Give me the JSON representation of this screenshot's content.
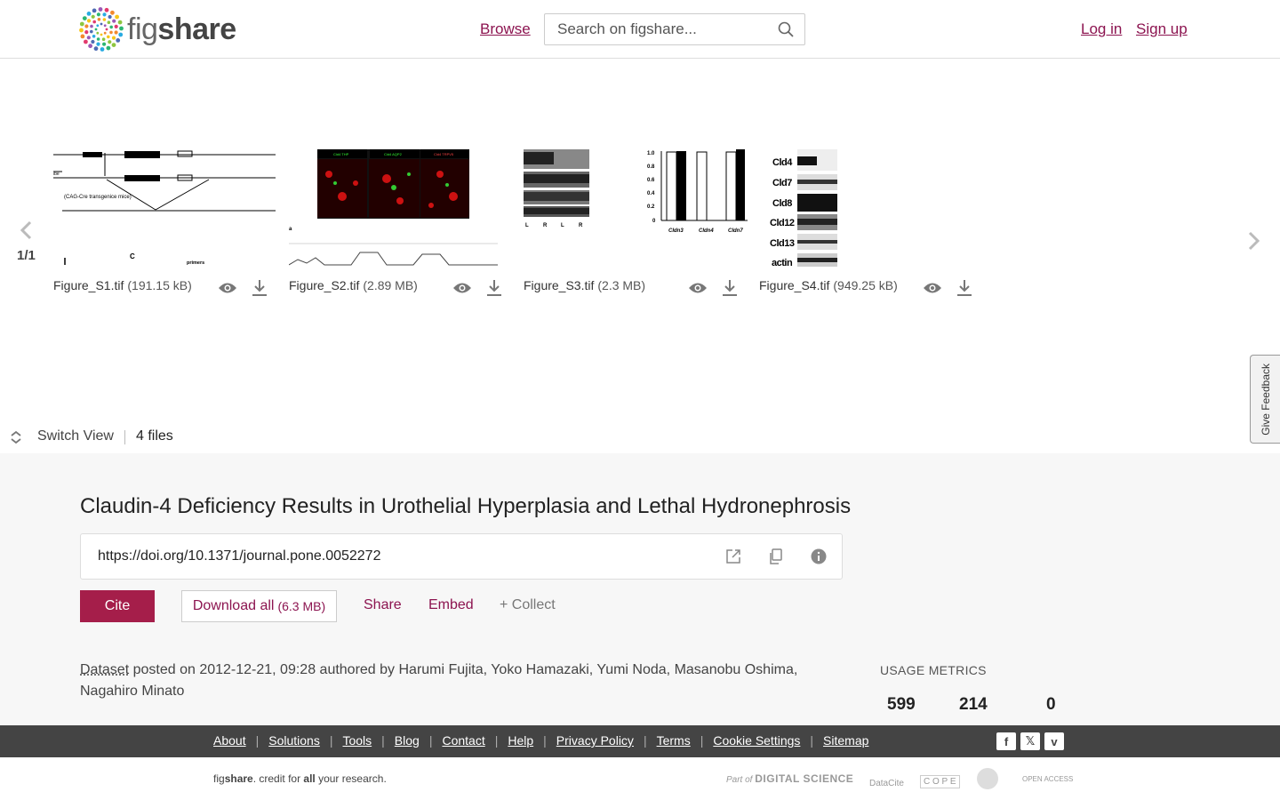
{
  "header": {
    "logo_fig": "fig",
    "logo_share": "share",
    "browse": "Browse",
    "search_placeholder": "Search on figshare...",
    "login": "Log in",
    "signup": "Sign up"
  },
  "carousel": {
    "pager": "1/1",
    "files": [
      {
        "name": "Figure_S1.tif",
        "size": "(191.15 kB)"
      },
      {
        "name": "Figure_S2.tif",
        "size": "(2.89 MB)"
      },
      {
        "name": "Figure_S3.tif",
        "size": "(2.3 MB)"
      },
      {
        "name": "Figure_S4.tif",
        "size": "(949.25 kB)"
      }
    ],
    "s1_labels": {
      "label_a": "(CAG-Cre transgenice mice)",
      "label_b": "C",
      "label_c": "primers",
      "label_d": "ibe"
    },
    "s2_labels": {
      "a": "Cld4 THP",
      "b": "Cld4 AQP2",
      "c": "Cld4 TRPV5"
    },
    "s3_labels": [
      "L",
      "R",
      "L",
      "R"
    ],
    "s3_chart_ticks": [
      "1.0",
      "0.8",
      "0.6",
      "0.4",
      "0.2",
      "0"
    ],
    "s3_chart_cats": [
      "Cldn3",
      "Cldn4",
      "Cldn7"
    ],
    "s4_labels": [
      "Cld4",
      "Cld7",
      "Cld8",
      "Cld12",
      "Cld13",
      "actin"
    ]
  },
  "feedback": "Give Feedback",
  "switch_view": "Switch View",
  "files_count": "4 files",
  "article": {
    "title": "Claudin-4 Deficiency Results in Urothelial Hyperplasia and Lethal Hydronephrosis",
    "doi": "https://doi.org/10.1371/journal.pone.0052272",
    "cite": "Cite",
    "download_all": "Download all",
    "download_size": "(6.3 MB)",
    "share": "Share",
    "embed": "Embed",
    "collect": "+ Collect",
    "type": "Dataset",
    "posted": "posted on 2012-12-21, 09:28 authored by Harumi Fujita, Yoko Hamazaki, Yumi Noda, Masanobu Oshima, Nagahiro Minato"
  },
  "usage": {
    "label": "USAGE METRICS",
    "values": [
      "599",
      "214",
      "0"
    ]
  },
  "footer": {
    "links": [
      "About",
      "Solutions",
      "Tools",
      "Blog",
      "Contact",
      "Help",
      "Privacy Policy",
      "Terms",
      "Cookie Settings",
      "Sitemap"
    ],
    "tagline_fig": "fig",
    "tagline_share": "share",
    "tagline_rest1": ". credit for ",
    "tagline_all": "all",
    "tagline_rest2": " your research.",
    "partners": {
      "ds_part": "Part of",
      "ds_name": "DIGITAL SCIENCE",
      "datacite": "DataCite",
      "cope": "C O P E",
      "open_access": "OPEN ACCESS"
    }
  },
  "colors": {
    "accent": "#a51e4a",
    "link": "#8c1450",
    "footer_bg": "#444444"
  }
}
